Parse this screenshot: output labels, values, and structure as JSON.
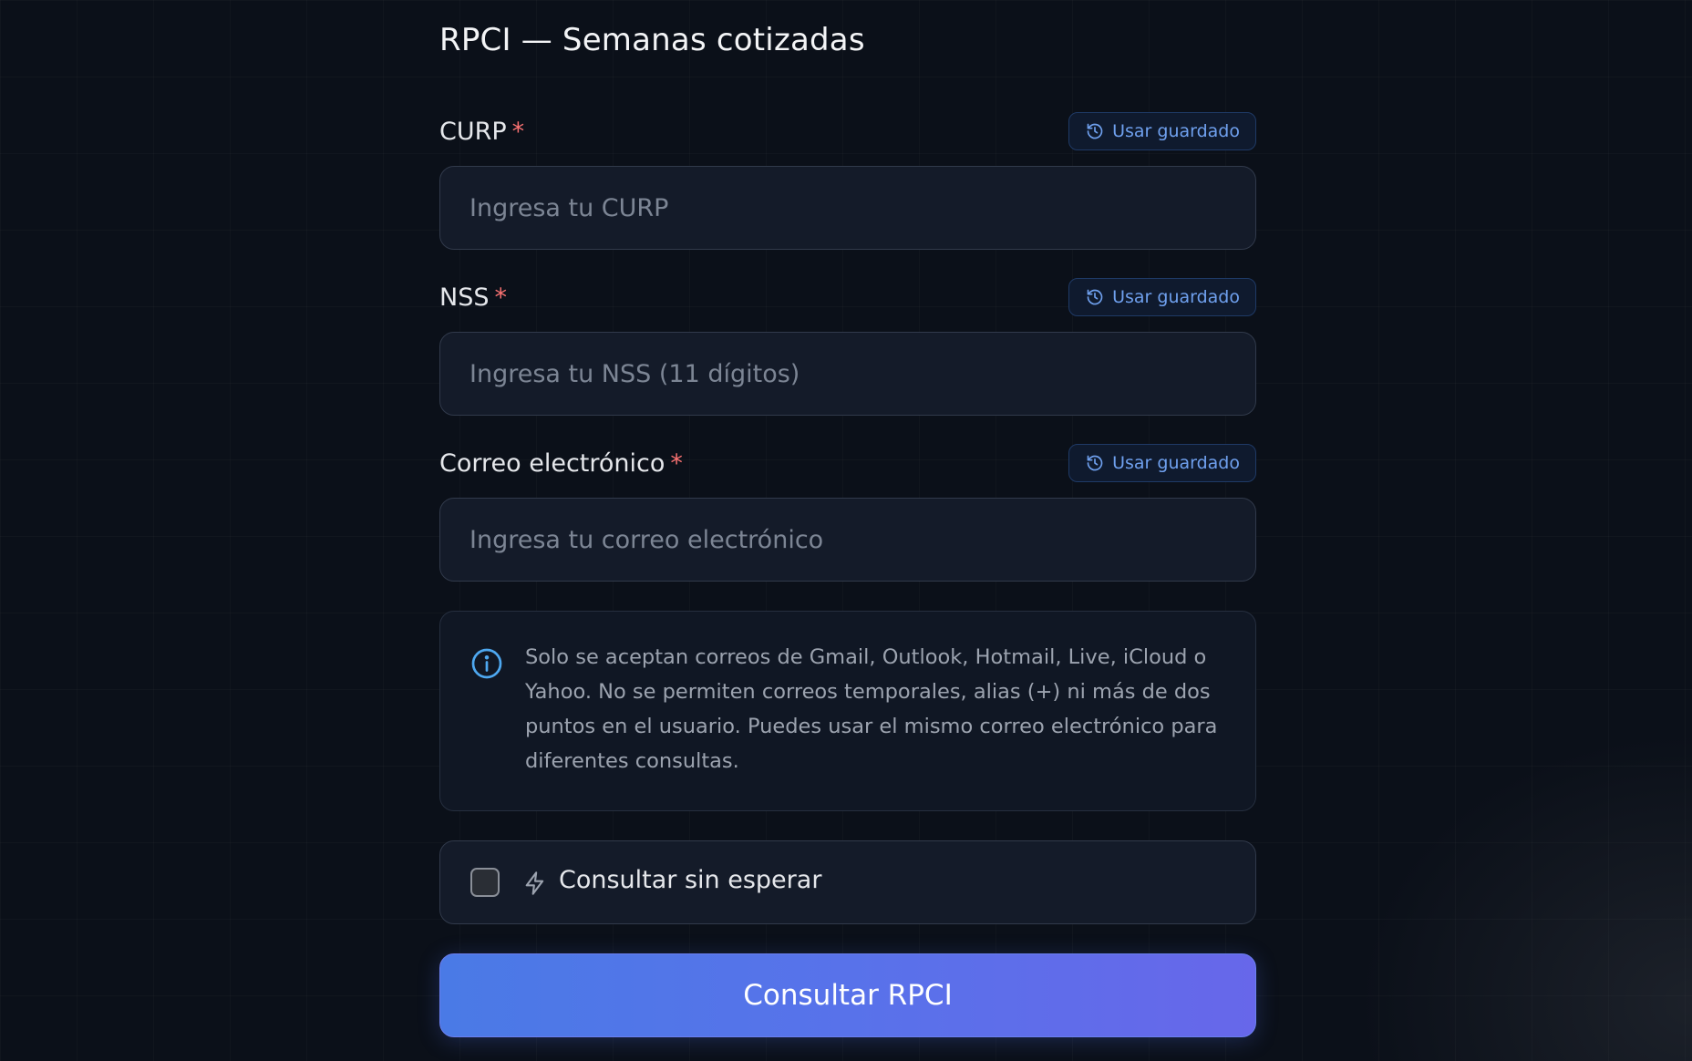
{
  "page": {
    "title": "RPCI — Semanas cotizadas"
  },
  "fields": {
    "curp": {
      "label": "CURP",
      "required_mark": "*",
      "saved_button": "Usar guardado",
      "value": "",
      "placeholder": "Ingresa tu CURP"
    },
    "nss": {
      "label": "NSS",
      "required_mark": "*",
      "saved_button": "Usar guardado",
      "value": "",
      "placeholder": "Ingresa tu NSS (11 dígitos)"
    },
    "email": {
      "label": "Correo electrónico",
      "required_mark": "*",
      "saved_button": "Usar guardado",
      "value": "",
      "placeholder": "Ingresa tu correo electrónico"
    }
  },
  "info": {
    "icon": "info-circle-icon",
    "text": "Solo se aceptan correos de Gmail, Outlook, Hotmail, Live, iCloud o Yahoo. No se permiten correos temporales, alias (+) ni más de dos puntos en el usuario. Puedes usar el mismo correo electrónico para diferentes consultas."
  },
  "fast_option": {
    "label": "Consultar sin esperar",
    "checked": false,
    "icon": "lightning-bolt-icon"
  },
  "submit": {
    "label": "Consultar RPCI"
  },
  "colors": {
    "background": "#0b1019",
    "required": "#f87171",
    "saved_button_text": "#6fa0ee",
    "info_icon": "#4ea8f0",
    "submit_gradient_start": "#4a7ae6",
    "submit_gradient_end": "#6767ea"
  }
}
